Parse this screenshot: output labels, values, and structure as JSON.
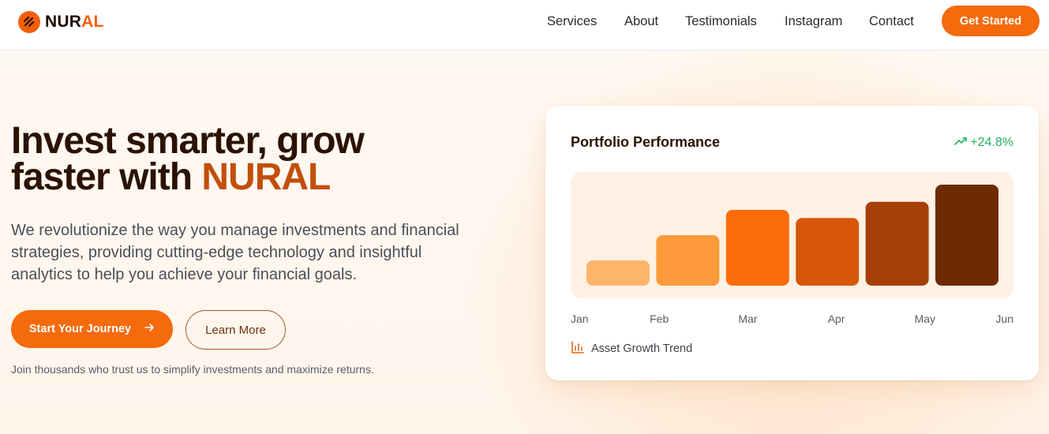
{
  "brand": {
    "name_part1": "NUR",
    "name_part2": "AL",
    "logo_icon": "stripes-logo-icon",
    "accent_color": "#f56a0c"
  },
  "nav": {
    "items": [
      {
        "label": "Services"
      },
      {
        "label": "About"
      },
      {
        "label": "Testimonials"
      },
      {
        "label": "Instagram"
      },
      {
        "label": "Contact"
      }
    ],
    "cta_label": "Get Started"
  },
  "hero": {
    "headline_line1": "Invest smarter, grow",
    "headline_line2_prefix": "faster with ",
    "headline_brand": "NURAL",
    "subtext": "We revolutionize the way you manage investments and financial strategies, providing cutting-edge technology and insightful analytics to help you achieve your financial goals.",
    "primary_button": "Start Your Journey",
    "primary_button_icon": "arrow-right-icon",
    "secondary_button": "Learn More",
    "trust_text": "Join thousands who trust us to simplify investments and maximize returns."
  },
  "card": {
    "title": "Portfolio Performance",
    "change_icon": "trending-up-icon",
    "change_value": "+24.8%",
    "change_color": "#22b35c",
    "footer_icon": "bar-chart-icon",
    "footer_label": "Asset Growth Trend"
  },
  "chart_data": {
    "type": "bar",
    "title": "",
    "categories": [
      "Jan",
      "Feb",
      "Mar",
      "Apr",
      "May",
      "Jun"
    ],
    "values": [
      25,
      50,
      75,
      67,
      83,
      100
    ],
    "ylim": [
      0,
      100
    ],
    "colors": [
      "#fdb56c",
      "#fd9a3b",
      "#fd6c0a",
      "#d6570a",
      "#a63f07",
      "#6e2a03"
    ],
    "grid": false,
    "legend": "none"
  }
}
